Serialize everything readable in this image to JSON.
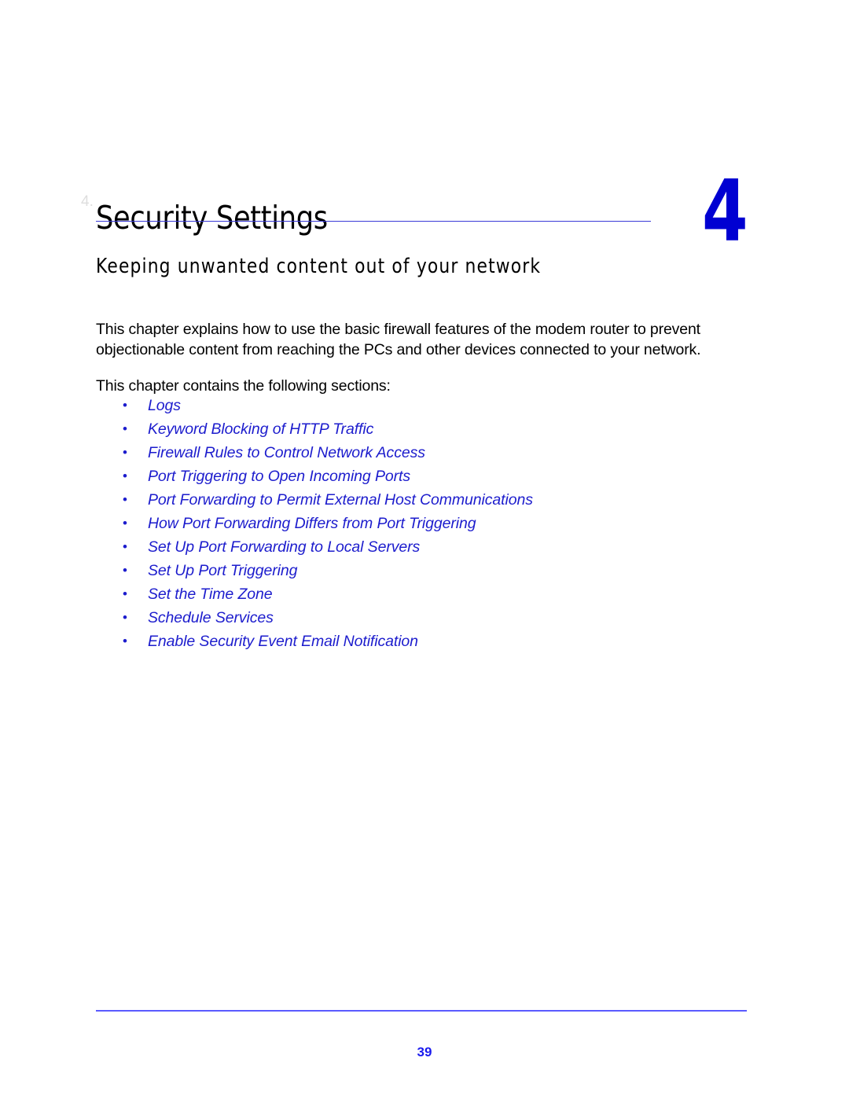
{
  "chapter": {
    "marker": "4.",
    "title": "Security Settings",
    "subtitle": "Keeping unwanted content out of your network",
    "number": "4",
    "accent_color": "#0000d2",
    "rule_color": "#3a3ad8"
  },
  "intro": {
    "paragraph_1": "This chapter explains how to use the basic firewall features of the modem router to prevent objectionable content from reaching the PCs and other devices connected to your network.",
    "paragraph_2": "This chapter contains the following sections:"
  },
  "sections": {
    "bullet_glyph": "•",
    "link_color": "#1c1ccd",
    "items": [
      {
        "label": "Logs"
      },
      {
        "label": "Keyword Blocking of HTTP Traffic"
      },
      {
        "label": "Firewall Rules to Control Network Access"
      },
      {
        "label": "Port Triggering to Open Incoming Ports"
      },
      {
        "label": "Port Forwarding to Permit External Host Communications"
      },
      {
        "label": "How Port Forwarding Differs from Port Triggering"
      },
      {
        "label": "Set Up Port Forwarding to Local Servers"
      },
      {
        "label": "Set Up Port Triggering"
      },
      {
        "label": "Set the Time Zone"
      },
      {
        "label": "Schedule Services"
      },
      {
        "label": "Enable Security Event Email Notification"
      }
    ]
  },
  "footer": {
    "page_number": "39",
    "rule_color": "#5a5aff"
  }
}
